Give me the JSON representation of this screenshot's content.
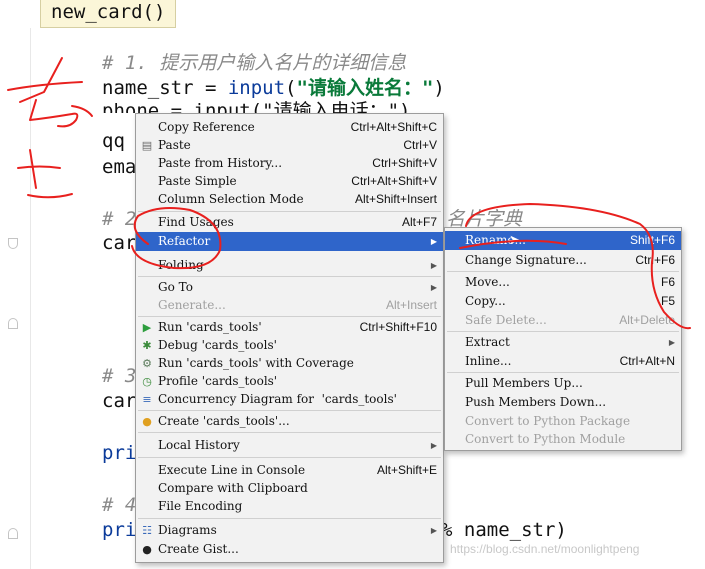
{
  "editor": {
    "top_function": "new_card()",
    "lines": {
      "l1": "# 1. 提示用户输入名片的详细信息",
      "l2a": "name_str = ",
      "l2b": "input",
      "l2c": "(",
      "l2d": "\"请输入姓名：\"",
      "l2e": ")",
      "l3": "phone = input(\"请输入电话：\")",
      "l4": "qq",
      "l5": "ema",
      "l6": "# 2",
      "l6b": "名片字典",
      "l7": "car",
      "l8": "# 3",
      "l9": "car",
      "l10": "pri",
      "l11": "# 4",
      "l12": "pri",
      "l12b": "% name_str)"
    },
    "watermark": "https://blog.csdn.net/moonlightpeng"
  },
  "context_menu": {
    "copy_reference": {
      "label": "Copy Reference",
      "shortcut": "Ctrl+Alt+Shift+C"
    },
    "paste": {
      "label": "Paste",
      "shortcut": "Ctrl+V"
    },
    "paste_history": {
      "label": "Paste from History...",
      "shortcut": "Ctrl+Shift+V"
    },
    "paste_simple": {
      "label": "Paste Simple",
      "shortcut": "Ctrl+Alt+Shift+V"
    },
    "column_mode": {
      "label": "Column Selection Mode",
      "shortcut": "Alt+Shift+Insert"
    },
    "find_usages": {
      "label": "Find Usages",
      "shortcut": "Alt+F7"
    },
    "refactor": {
      "label": "Refactor"
    },
    "folding": {
      "label": "Folding"
    },
    "go_to": {
      "label": "Go To"
    },
    "generate": {
      "label": "Generate...",
      "shortcut": "Alt+Insert"
    },
    "run": {
      "label": "Run 'cards_tools'",
      "shortcut": "Ctrl+Shift+F10"
    },
    "debug": {
      "label": "Debug 'cards_tools'"
    },
    "run_coverage": {
      "label": "Run 'cards_tools' with Coverage"
    },
    "profile": {
      "label": "Profile 'cards_tools'"
    },
    "concurrency": {
      "label": "Concurrency Diagram for  'cards_tools'"
    },
    "create": {
      "label": "Create 'cards_tools'..."
    },
    "local_history": {
      "label": "Local History"
    },
    "execute_line": {
      "label": "Execute Line in Console",
      "shortcut": "Alt+Shift+E"
    },
    "compare_clipboard": {
      "label": "Compare with Clipboard"
    },
    "file_encoding": {
      "label": "File Encoding"
    },
    "diagrams": {
      "label": "Diagrams"
    },
    "create_gist": {
      "label": "Create Gist..."
    }
  },
  "refactor_menu": {
    "rename": {
      "label": "Rename...",
      "shortcut": "Shift+F6"
    },
    "change_signature": {
      "label": "Change Signature...",
      "shortcut": "Ctrl+F6"
    },
    "move": {
      "label": "Move...",
      "shortcut": "F6"
    },
    "copy": {
      "label": "Copy...",
      "shortcut": "F5"
    },
    "safe_delete": {
      "label": "Safe Delete...",
      "shortcut": "Alt+Delete"
    },
    "extract": {
      "label": "Extract"
    },
    "inline": {
      "label": "Inline...",
      "shortcut": "Ctrl+Alt+N"
    },
    "pull_up": {
      "label": "Pull Members Up..."
    },
    "push_down": {
      "label": "Push Members Down..."
    },
    "convert_package": {
      "label": "Convert to Python Package"
    },
    "convert_module": {
      "label": "Convert to Python Module"
    }
  },
  "colors": {
    "selection": "#2f65ca",
    "annotation": "#e8201e"
  },
  "icons": [
    "paste-icon",
    "run-icon",
    "debug-icon",
    "coverage-icon",
    "profile-icon",
    "concurrency-icon",
    "create-config-icon",
    "diagrams-icon",
    "github-icon",
    "submenu-arrow-icon",
    "mouse-cursor-icon"
  ]
}
